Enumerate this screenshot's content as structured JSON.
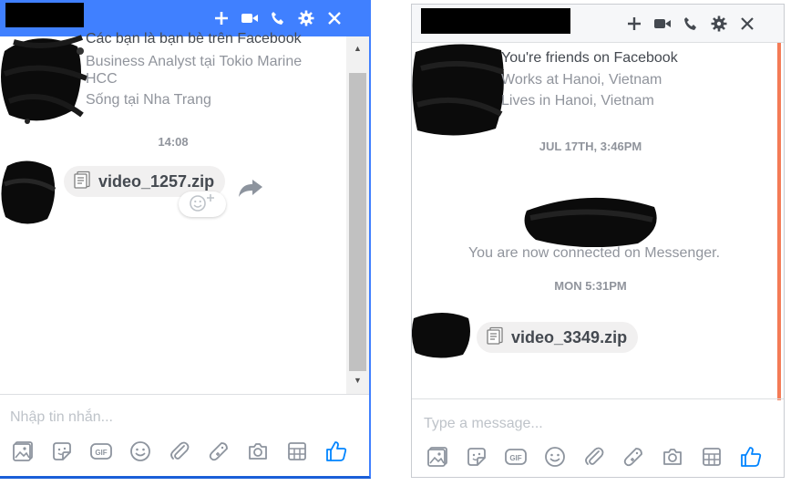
{
  "left_window": {
    "header_icons": [
      "plus-icon",
      "video-call-icon",
      "phone-icon",
      "gear-icon",
      "close-icon"
    ],
    "friends_line": "Các bạn là bạn bè trên Facebook",
    "work_line_1": "Business Analyst tại Tokio Marine",
    "work_line_2": "HCC",
    "lives_line": "Sống tại Nha Trang",
    "timestamp": "14:08",
    "attachment_name": "video_1257.zip",
    "composer_placeholder": "Nhập tin nhắn..."
  },
  "right_window": {
    "header_icons": [
      "plus-icon",
      "video-call-icon",
      "phone-icon",
      "gear-icon",
      "close-icon"
    ],
    "friends_line": "You're friends on Facebook",
    "work_line": "Works at Hanoi, Vietnam",
    "lives_line": "Lives in Hanoi, Vietnam",
    "timestamp_1": "JUL 17TH, 3:46PM",
    "connected_text": "You are now connected on Messenger.",
    "timestamp_2": "MON 5:31PM",
    "attachment_name": "video_3349.zip",
    "composer_placeholder": "Type a message..."
  },
  "toolbar_icons": [
    "photo-icon",
    "sticker-icon",
    "gif-icon",
    "emoji-icon",
    "attach-icon",
    "game-icon",
    "camera-icon",
    "plan-icon",
    "like-icon"
  ],
  "colors": {
    "messenger_blue": "#4080ff",
    "like_blue": "#0084ff",
    "scroll_accent": "#f47b56",
    "muted_text": "#90949c",
    "bubble_gray": "#f1f0f0"
  }
}
